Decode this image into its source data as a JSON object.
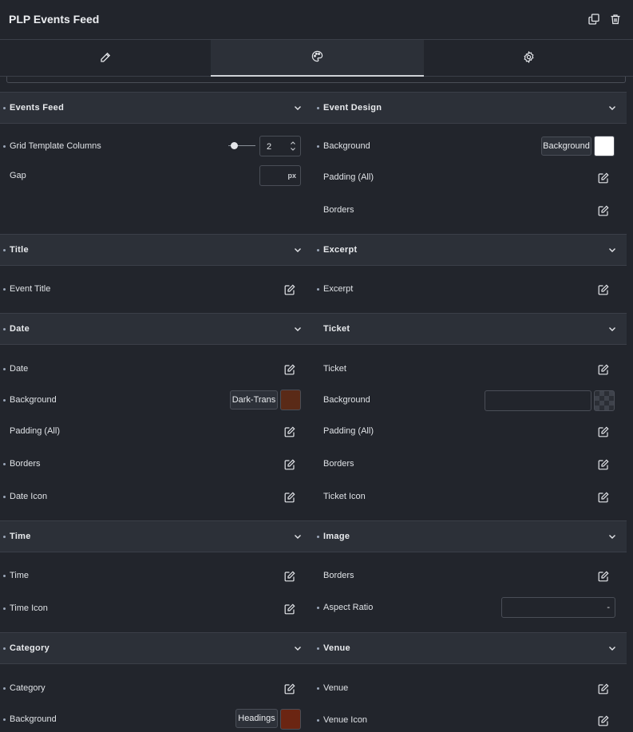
{
  "header": {
    "title": "PLP Events Feed",
    "icons": [
      "duplicate-icon",
      "trash-icon"
    ]
  },
  "tabs": [
    {
      "icon": "pencil-icon",
      "name": "content",
      "active": false
    },
    {
      "icon": "palette-icon",
      "name": "style",
      "active": true
    },
    {
      "icon": "gear-icon",
      "name": "advanced",
      "active": false
    }
  ],
  "colors": {
    "panel_bg": "#22252c",
    "section_bg": "#2c3038",
    "border": "#3b3f48",
    "swatch_brown": "#5a2a17",
    "swatch_brown2": "#6b2512",
    "swatch_white": "#ffffff"
  },
  "left": {
    "events_feed": {
      "title": "Events Feed",
      "grid_template_columns": {
        "label": "Grid Template Columns",
        "value": "2",
        "slider_level": 0.05
      },
      "gap": {
        "label": "Gap",
        "unit": "px",
        "value": ""
      }
    },
    "title_sec": {
      "title": "Title",
      "event_title": "Event Title"
    },
    "date_sec": {
      "title": "Date",
      "date": "Date",
      "background": "Background",
      "background_button": "Dark-Trans",
      "padding": "Padding (All)",
      "borders": "Borders",
      "date_icon": "Date Icon"
    },
    "time_sec": {
      "title": "Time",
      "time": "Time",
      "time_icon": "Time Icon"
    },
    "category_sec": {
      "title": "Category",
      "category": "Category",
      "background": "Background",
      "background_button": "Headings"
    }
  },
  "right": {
    "event_design": {
      "title": "Event Design",
      "background": "Background",
      "background_button": "Background",
      "padding": "Padding (All)",
      "borders": "Borders"
    },
    "excerpt_sec": {
      "title": "Excerpt",
      "excerpt": "Excerpt"
    },
    "ticket_sec": {
      "title": "Ticket",
      "ticket": "Ticket",
      "background": "Background",
      "background_value": "",
      "padding": "Padding (All)",
      "borders": "Borders",
      "ticket_icon": "Ticket Icon"
    },
    "image_sec": {
      "title": "Image",
      "borders": "Borders",
      "aspect_ratio": "Aspect Ratio",
      "aspect_ratio_value": "-"
    },
    "venue_sec": {
      "title": "Venue",
      "venue": "Venue",
      "venue_icon": "Venue Icon"
    }
  }
}
